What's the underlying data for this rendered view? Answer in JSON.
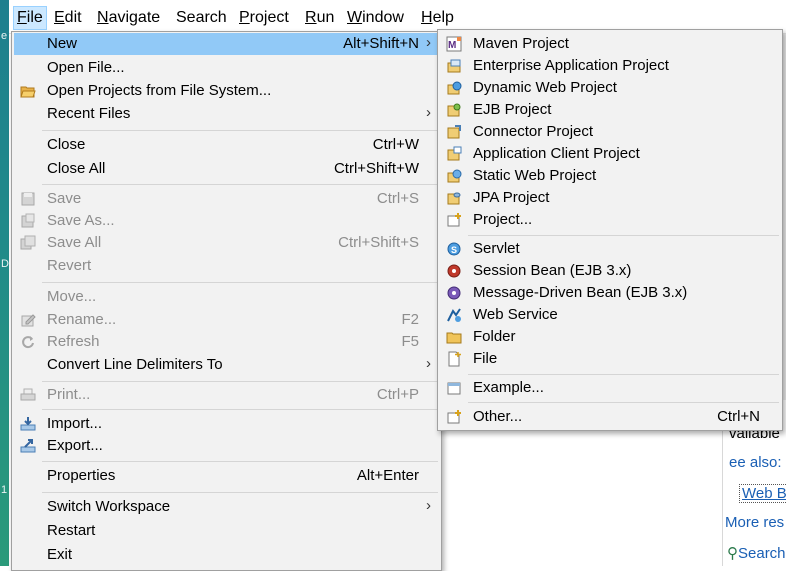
{
  "menubar": [
    {
      "label": "File",
      "mnemonic": "F",
      "rest": "ile",
      "active": true
    },
    {
      "label": "Edit",
      "mnemonic": "E",
      "rest": "dit"
    },
    {
      "label": "Navigate",
      "mnemonic": "N",
      "rest": "avigate"
    },
    {
      "label": "Search",
      "mnemonic": "",
      "rest": "Search"
    },
    {
      "label": "Project",
      "mnemonic": "P",
      "rest": "roject"
    },
    {
      "label": "Run",
      "mnemonic": "R",
      "rest": "un"
    },
    {
      "label": "Window",
      "mnemonic": "W",
      "rest": "indow"
    },
    {
      "label": "Help",
      "mnemonic": "H",
      "rest": "elp"
    }
  ],
  "file_menu": {
    "new": {
      "label": "New",
      "accel": "Alt+Shift+N"
    },
    "open_file": {
      "label": "Open File..."
    },
    "open_projects": {
      "label": "Open Projects from File System..."
    },
    "recent_files": {
      "label": "Recent Files"
    },
    "close": {
      "label": "Close",
      "accel": "Ctrl+W"
    },
    "close_all": {
      "label": "Close All",
      "accel": "Ctrl+Shift+W"
    },
    "save": {
      "label": "Save",
      "accel": "Ctrl+S"
    },
    "save_as": {
      "label": "Save As..."
    },
    "save_all": {
      "label": "Save All",
      "accel": "Ctrl+Shift+S"
    },
    "revert": {
      "label": "Revert"
    },
    "move": {
      "label": "Move..."
    },
    "rename": {
      "label": "Rename...",
      "accel": "F2"
    },
    "refresh": {
      "label": "Refresh",
      "accel": "F5"
    },
    "convert_line_delimiters": {
      "label": "Convert Line Delimiters To"
    },
    "print": {
      "label": "Print...",
      "accel": "Ctrl+P"
    },
    "import": {
      "label": "Import..."
    },
    "export": {
      "label": "Export..."
    },
    "properties": {
      "label": "Properties",
      "accel": "Alt+Enter"
    },
    "switch_workspace": {
      "label": "Switch Workspace"
    },
    "restart": {
      "label": "Restart"
    },
    "exit": {
      "label": "Exit"
    }
  },
  "new_menu": {
    "maven_project": {
      "label": "Maven Project"
    },
    "enterprise_app_project": {
      "label": "Enterprise Application Project"
    },
    "dynamic_web_project": {
      "label": "Dynamic Web Project"
    },
    "ejb_project": {
      "label": "EJB Project"
    },
    "connector_project": {
      "label": "Connector Project"
    },
    "app_client_project": {
      "label": "Application Client Project"
    },
    "static_web_project": {
      "label": "Static Web Project"
    },
    "jpa_project": {
      "label": "JPA Project"
    },
    "project": {
      "label": "Project..."
    },
    "servlet": {
      "label": "Servlet"
    },
    "session_bean": {
      "label": "Session Bean (EJB 3.x)"
    },
    "message_driven_bean": {
      "label": "Message-Driven Bean (EJB 3.x)"
    },
    "web_service": {
      "label": "Web Service"
    },
    "folder": {
      "label": "Folder"
    },
    "file": {
      "label": "File"
    },
    "example": {
      "label": "Example..."
    },
    "other": {
      "label": "Other...",
      "accel": "Ctrl+N"
    }
  },
  "background": {
    "left_marks": [
      "e",
      "D",
      "1"
    ],
    "available": "vailable",
    "see_also": "ee also:",
    "web_link": "Web B",
    "more_res": "More res",
    "search": "Search"
  }
}
